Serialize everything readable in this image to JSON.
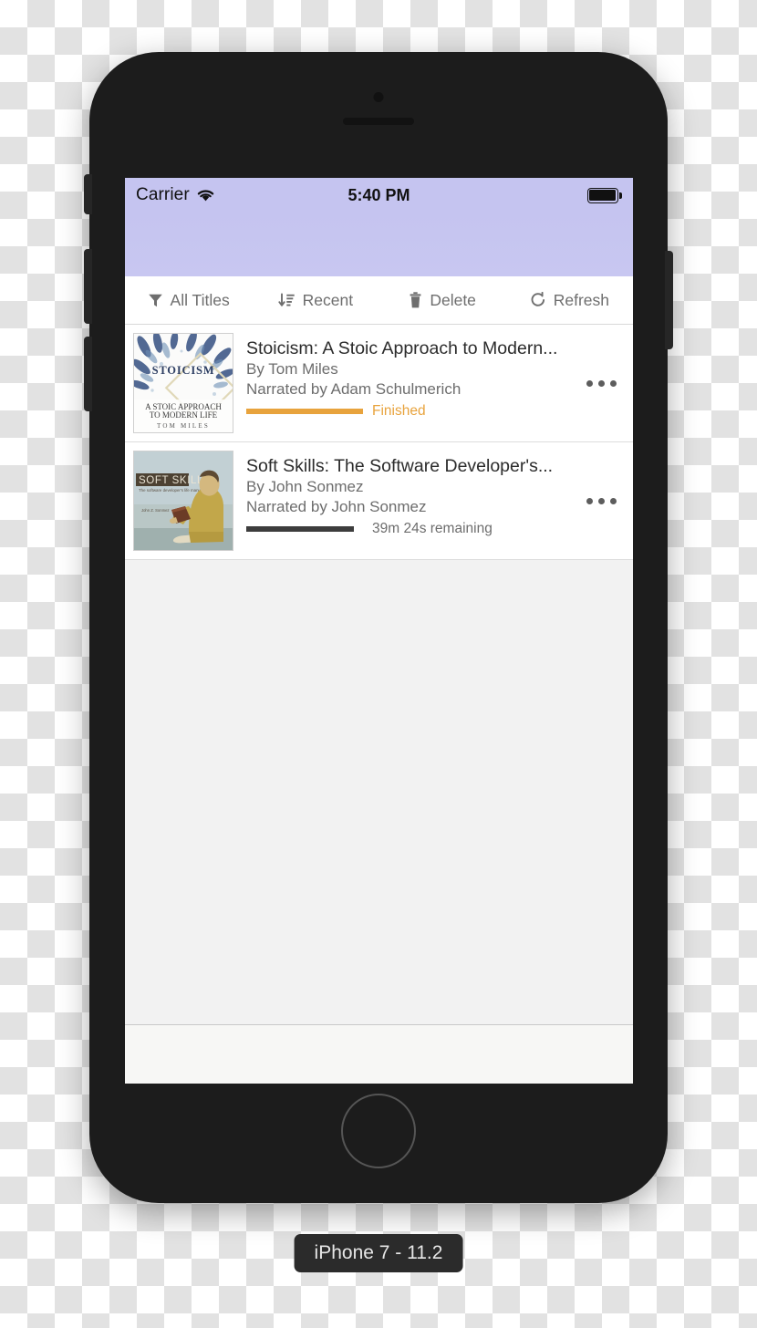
{
  "status_bar": {
    "carrier": "Carrier",
    "wifi_icon": "wifi-icon",
    "time": "5:40 PM",
    "battery_icon": "battery-full-icon"
  },
  "toolbar": {
    "items": [
      {
        "label": "All Titles",
        "icon": "filter-funnel-icon"
      },
      {
        "label": "Recent",
        "icon": "sort-descending-icon"
      },
      {
        "label": "Delete",
        "icon": "trash-icon"
      },
      {
        "label": "Refresh",
        "icon": "refresh-icon"
      }
    ]
  },
  "library": {
    "books": [
      {
        "title": "Stoicism: A Stoic Approach to Modern...",
        "author": "By Tom Miles",
        "narrator": "Narrated by Adam Schulmerich",
        "progress_text": "Finished",
        "progress_percent": 100,
        "progress_color": "#e8a33d",
        "progress_text_color": "#e8a33d",
        "more_icon": "more-horizontal-icon",
        "cover": {
          "name": "stoicism-cover",
          "title_text": "STOICISM",
          "subtitle_text": "A STOIC APPROACH TO MODERN LIFE",
          "author_text": "T O M   M I L E S"
        }
      },
      {
        "title": "Soft Skills: The Software Developer's...",
        "author": "By John Sonmez",
        "narrator": "Narrated by John Sonmez",
        "progress_text": "39m 24s remaining",
        "progress_percent": 92,
        "progress_color": "#3d3d3d",
        "progress_text_color": "#6d6d6d",
        "more_icon": "more-horizontal-icon",
        "cover": {
          "name": "soft-skills-cover",
          "title_text": "SOFT SKILLS",
          "subtitle_text": "The software developer's life manual",
          "author_text": "John Z. Sonmez"
        }
      }
    ]
  },
  "device_label": "iPhone 7 - 11.2",
  "colors": {
    "nav_purple": "#c5c4f0",
    "screen_background": "#f2f2f2",
    "accent_orange": "#e8a33d"
  }
}
